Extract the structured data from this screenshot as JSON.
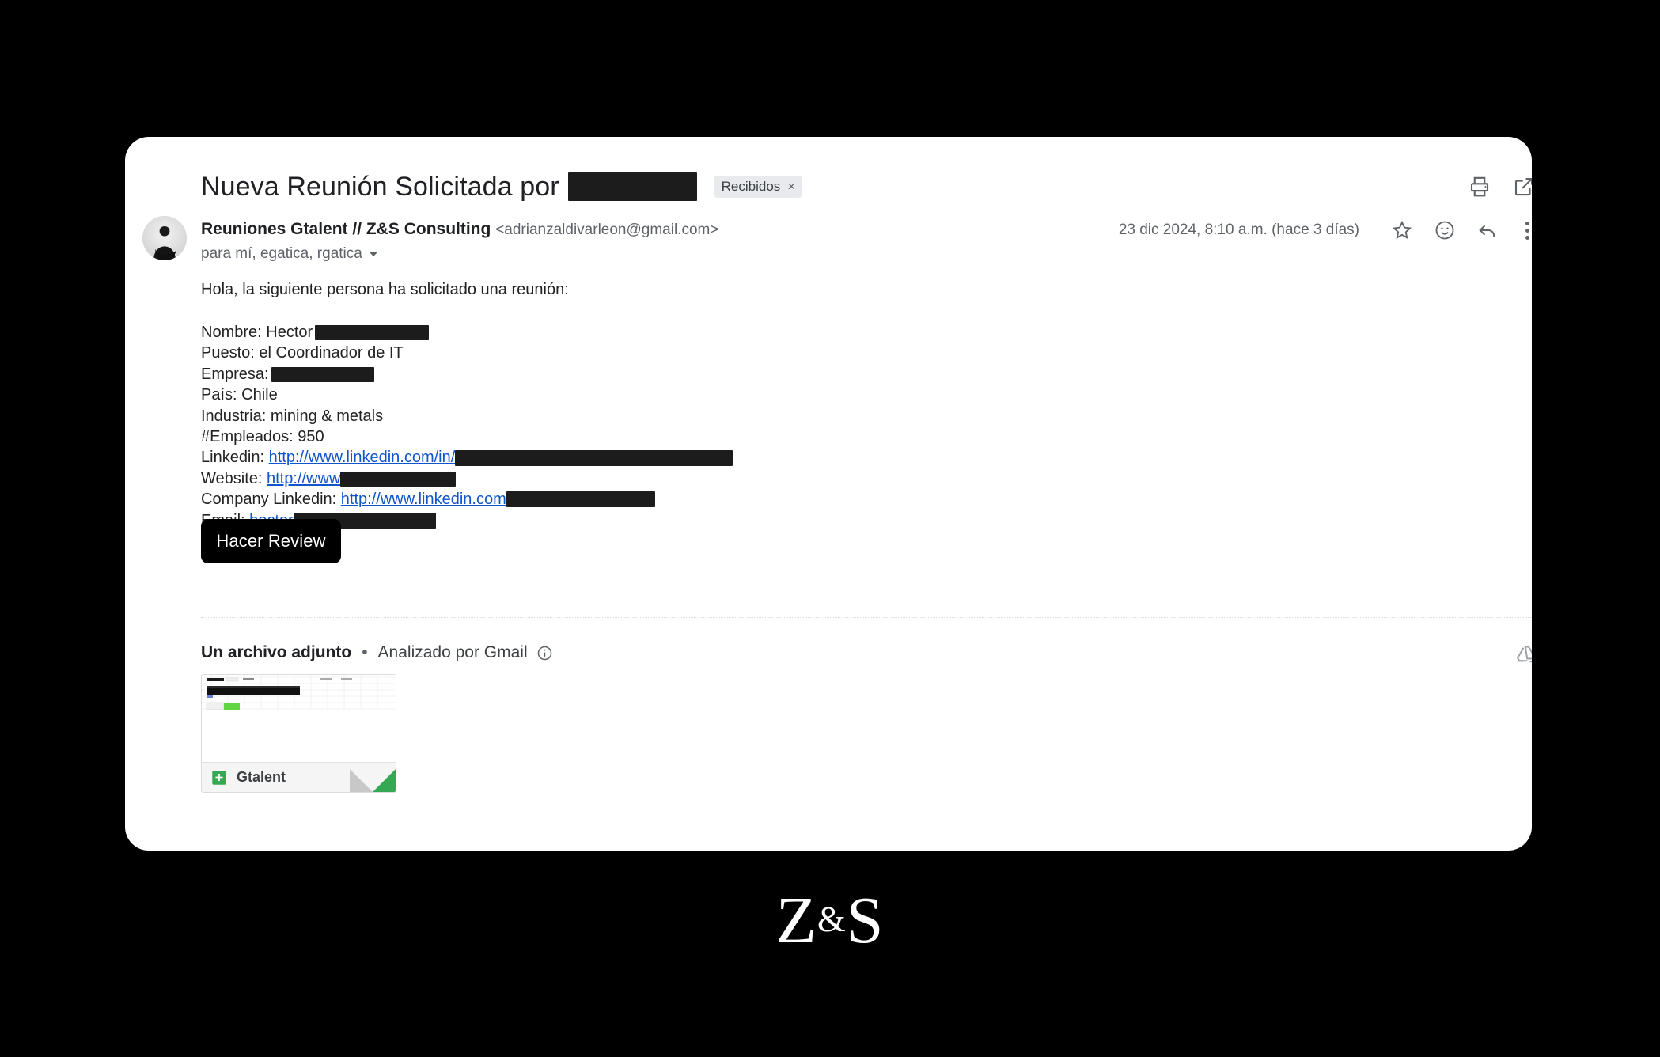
{
  "email": {
    "subject": "Nueva Reunión Solicitada por",
    "subject_redacted": true,
    "label_chip": "Recibidos",
    "label_chip_close": "×",
    "sender_name": "Reuniones Gtalent // Z&S Consulting",
    "sender_email": "<adrianzaldivarleon@gmail.com>",
    "recipients": "para mí, egatica, rgatica",
    "timestamp": "23 dic 2024, 8:10 a.m. (hace 3 días)"
  },
  "body": {
    "greeting": "Hola, la siguiente persona ha solicitado una reunión:",
    "fields": [
      {
        "label": "Nombre: Hector",
        "redacted": true
      },
      {
        "label": "Puesto: el Coordinador de IT",
        "redacted": false
      },
      {
        "label": "Empresa:",
        "redacted": true
      },
      {
        "label": "País: Chile",
        "redacted": false
      },
      {
        "label": "Industria: mining & metals",
        "redacted": false
      },
      {
        "label": "#Empleados: 950",
        "redacted": false
      }
    ],
    "links": [
      {
        "label": "Linkedin: ",
        "url_text": "http://www.linkedin.com/in/",
        "redacted": true
      },
      {
        "label": "Website: ",
        "url_text": "http://www",
        "redacted": true
      },
      {
        "label": "Company Linkedin: ",
        "url_text": "http://www.linkedin.com",
        "redacted": true
      },
      {
        "label": "Email: ",
        "url_text": "hector",
        "redacted": true
      }
    ],
    "cta_label": "Hacer Review"
  },
  "attachments": {
    "header_title": "Un archivo adjunto",
    "separator": "•",
    "scanned_text": "Analizado por Gmail",
    "info_icon": "info-icon",
    "drive_icon": "add-to-drive-icon",
    "items": [
      {
        "name": "Gtalent",
        "type": "google-sheets"
      }
    ]
  },
  "toolbar": {
    "print_icon": "print-icon",
    "open_new_window_icon": "open-in-new-window-icon",
    "star_icon": "star-icon",
    "emoji_icon": "emoji-reaction-icon",
    "reply_icon": "reply-icon",
    "more_icon": "more-options-icon"
  },
  "branding": {
    "logo_left": "Z",
    "logo_amp": "&",
    "logo_right": "S"
  },
  "colors": {
    "background": "#000000",
    "card": "#ffffff",
    "link": "#1155cc",
    "redaction": "#1c1c1c",
    "cta_bg": "#000000",
    "chip_bg": "#e8eaed",
    "sheets_green": "#34a853"
  }
}
